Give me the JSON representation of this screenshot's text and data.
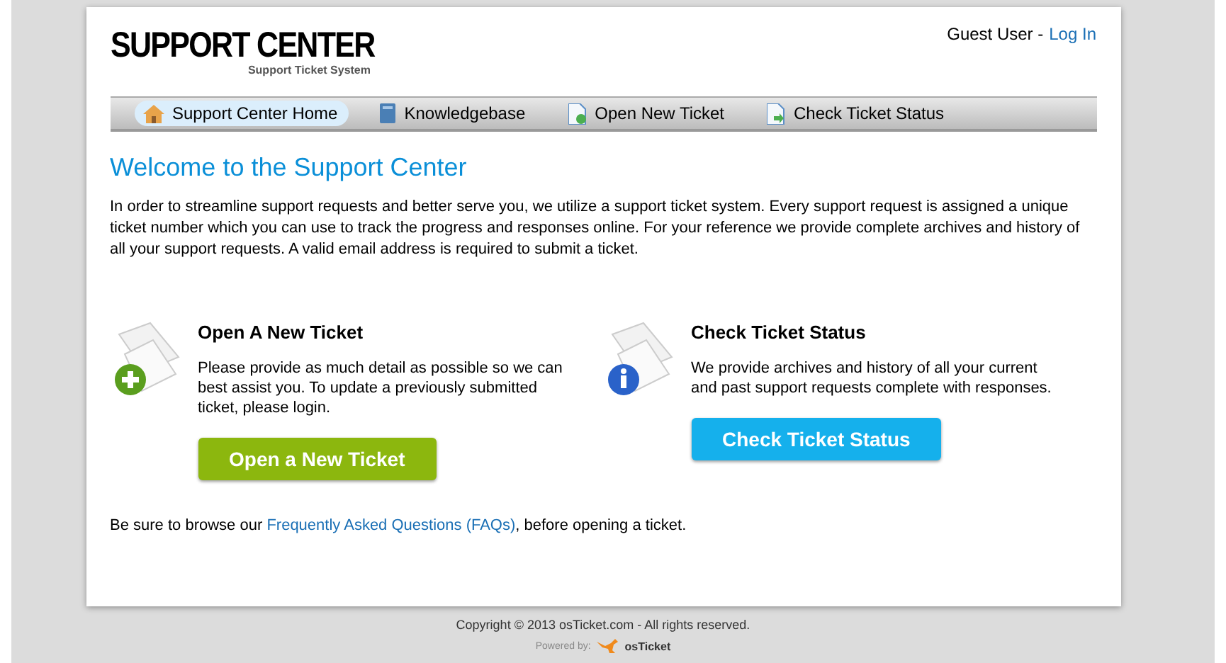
{
  "header": {
    "logo_title": "SUPPORT CENTER",
    "logo_subtitle": "Support Ticket System",
    "user": "Guest User -",
    "login_link": "Log In"
  },
  "nav": [
    {
      "label": "Support Center Home",
      "kind": "home",
      "selected": true
    },
    {
      "label": "Knowledgebase",
      "kind": "book",
      "selected": false
    },
    {
      "label": "Open New Ticket",
      "kind": "new",
      "selected": false
    },
    {
      "label": "Check Ticket Status",
      "kind": "status",
      "selected": false
    }
  ],
  "welcome": {
    "title": "Welcome to the Support Center",
    "text": "In order to streamline support requests and better serve you, we utilize a support ticket system. Every support request is assigned a unique ticket number which you can use to track the progress and responses online. For your reference we provide complete archives and history of all your support requests. A valid email address is required to submit a ticket."
  },
  "actions": [
    {
      "kind": "new",
      "title": "Open A New Ticket",
      "text": "Please provide as much detail as possible so we can best assist you. To update a previously submitted ticket, please login.",
      "button": "Open a New Ticket"
    },
    {
      "kind": "info",
      "title": "Check Ticket Status",
      "text": "We provide archives and history of all your current and past support requests complete with responses.",
      "button": "Check Ticket Status"
    }
  ],
  "faq_note": {
    "before": "Be sure to browse our",
    "link": "Frequently Asked Questions (FAQs)",
    "after": ", before opening a ticket."
  },
  "footer": {
    "copyright": "Copyright © 2013 osTicket.com - All rights reserved.",
    "powered_by": "Powered by:",
    "brand": "osTicket"
  }
}
